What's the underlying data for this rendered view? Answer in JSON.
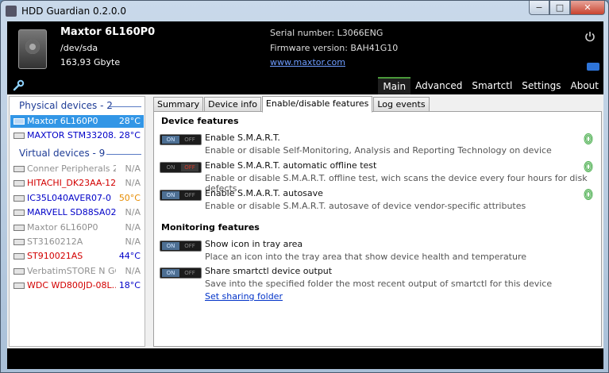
{
  "window": {
    "title": "HDD Guardian 0.2.0.0",
    "min": "−",
    "max": "□",
    "close": "✕"
  },
  "header": {
    "model": "Maxtor 6L160P0",
    "device": "/dev/sda",
    "size": "163,93 Gbyte",
    "serial": "Serial number: L3066ENG",
    "firmware": "Firmware version: BAH41G10",
    "link": "www.maxtor.com"
  },
  "nav": {
    "tabs": [
      "Main",
      "Advanced",
      "Smartctl",
      "Settings",
      "About"
    ],
    "active": "Main"
  },
  "sidebar": {
    "physical_header": "Physical devices - 2",
    "virtual_header": "Virtual devices - 9",
    "physical": [
      {
        "name": "Maxtor 6L160P0",
        "temp": "28°C",
        "color": "#ffffff",
        "temp_color": "#ffffff",
        "selected": true
      },
      {
        "name": "MAXTOR STM33208...",
        "temp": "28°C",
        "color": "#0000c8",
        "temp_color": "#0000c8",
        "selected": false
      }
    ],
    "virtual": [
      {
        "name": "Conner Peripherals 2...",
        "temp": "N/A",
        "color": "#909090",
        "temp_color": "#909090"
      },
      {
        "name": "HITACHI_DK23AA-12B",
        "temp": "N/A",
        "color": "#d20000",
        "temp_color": "#909090"
      },
      {
        "name": "IC35L040AVER07-0",
        "temp": "50°C",
        "color": "#0000c8",
        "temp_color": "#e68c00"
      },
      {
        "name": "MARVELL SD88SA02...",
        "temp": "N/A",
        "color": "#0000c8",
        "temp_color": "#909090"
      },
      {
        "name": "Maxtor 6L160P0",
        "temp": "N/A",
        "color": "#909090",
        "temp_color": "#909090"
      },
      {
        "name": "ST3160212A",
        "temp": "N/A",
        "color": "#909090",
        "temp_color": "#909090"
      },
      {
        "name": "ST910021AS",
        "temp": "44°C",
        "color": "#d20000",
        "temp_color": "#0000c8"
      },
      {
        "name": "VerbatimSTORE N GO",
        "temp": "N/A",
        "color": "#909090",
        "temp_color": "#909090"
      },
      {
        "name": "WDC WD800JD-08L...",
        "temp": "18°C",
        "color": "#d20000",
        "temp_color": "#0000c8"
      }
    ]
  },
  "subtabs": {
    "items": [
      "Summary",
      "Device info",
      "Enable/disable features",
      "Log events"
    ],
    "active": "Enable/disable features"
  },
  "panel": {
    "device_features_heading": "Device features",
    "monitoring_features_heading": "Monitoring features",
    "toggle_on": "ON",
    "toggle_off": "OFF",
    "device_features": [
      {
        "title": "Enable S.M.A.R.T.",
        "desc": "Enable or disable Self-Monitoring, Analysis and Reporting Technology on device",
        "state": "on"
      },
      {
        "title": "Enable S.M.A.R.T. automatic offline test",
        "desc": "Enable or disable S.M.A.R.T. offline test, wich scans the device every four hours for disk defects",
        "state": "off"
      },
      {
        "title": "Enable S.M.A.R.T. autosave",
        "desc": "Enable or disable S.M.A.R.T. autosave of device vendor-specific attributes",
        "state": "on"
      }
    ],
    "monitoring_features": [
      {
        "title": "Show icon in tray area",
        "desc": "Place an icon into the tray area that show device health and temperature",
        "state": "on"
      },
      {
        "title": "Share smartctl device output",
        "desc": "Save into the specified folder the most recent output of smartctl for this device",
        "state": "on"
      }
    ],
    "sharing_link": "Set sharing folder"
  },
  "colors": {
    "accent_nav": "#4a9a3a",
    "selection": "#3296e6",
    "link": "#0032c8"
  }
}
